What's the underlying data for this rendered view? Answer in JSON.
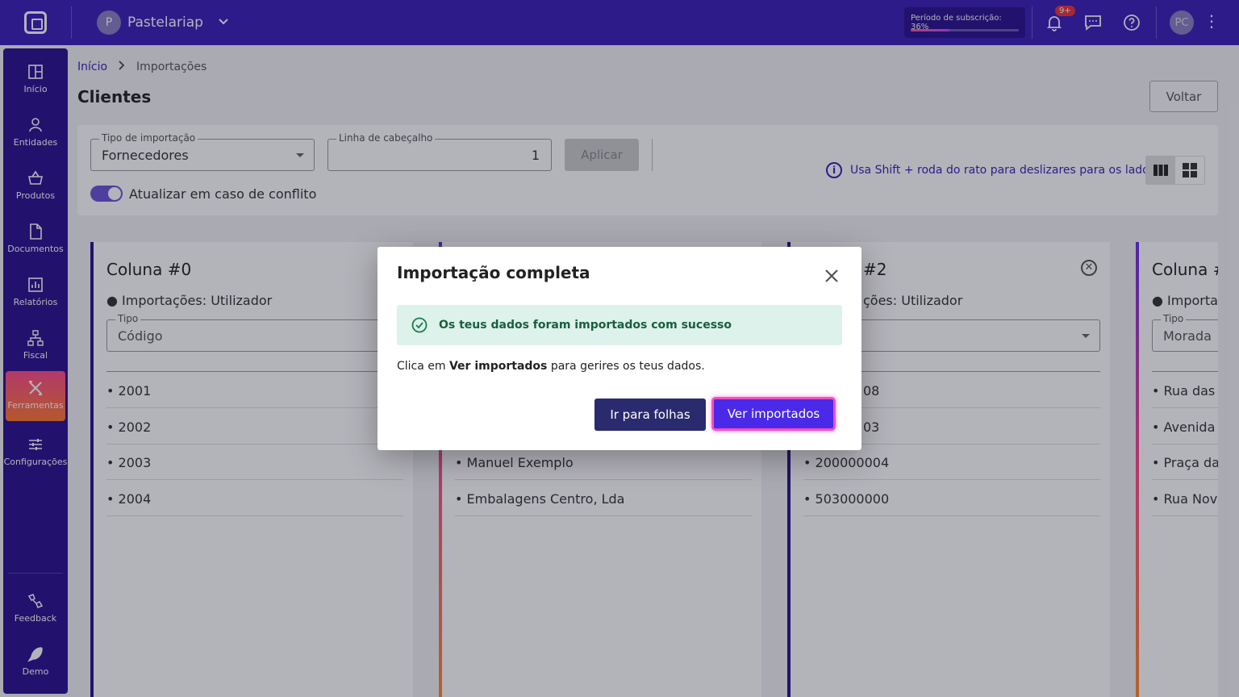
{
  "topbar": {
    "company_initial": "P",
    "company_name": "Pastelariap",
    "subscription_label": "Período de subscrição: 36%",
    "subscription_progress": 0.36,
    "notifications_badge": "9+",
    "user_initials": "PC"
  },
  "sidebar": {
    "items": [
      {
        "label": "Início",
        "icon": "home-icon"
      },
      {
        "label": "Entidades",
        "icon": "person-icon"
      },
      {
        "label": "Produtos",
        "icon": "basket-icon"
      },
      {
        "label": "Documentos",
        "icon": "document-icon"
      },
      {
        "label": "Relatórios",
        "icon": "chart-icon"
      },
      {
        "label": "Fiscal",
        "icon": "hierarchy-icon"
      },
      {
        "label": "Ferramentas",
        "icon": "tools-icon"
      },
      {
        "label": "Configurações",
        "icon": "sliders-icon"
      }
    ],
    "bottom": [
      {
        "label": "Feedback",
        "icon": "feedback-icon"
      },
      {
        "label": "Demo",
        "icon": "rocket-icon"
      }
    ]
  },
  "breadcrumb": {
    "home": "Início",
    "current": "Importações"
  },
  "page": {
    "title": "Clientes",
    "back_label": "Voltar"
  },
  "filters": {
    "import_type_label": "Tipo de importação",
    "import_type_value": "Fornecedores",
    "header_line_label": "Linha de cabeçalho",
    "header_line_value": "1",
    "apply_label": "Aplicar",
    "conflict_label": "Atualizar em caso de conflito",
    "hint": "Usa Shift + roda do rato para deslizares para os lados"
  },
  "columns": [
    {
      "title": "Coluna #0",
      "sub": "Importações: Utilizador",
      "type_label": "Tipo",
      "type_value": "Código",
      "rows": [
        "• 2001",
        "• 2002",
        "• 2003",
        "• 2004"
      ]
    },
    {
      "title": "",
      "sub": "",
      "type_label": "",
      "type_value": "",
      "rows": [
        "",
        "",
        "• Manuel Exemplo",
        "• Embalagens Centro, Lda"
      ]
    },
    {
      "title": "#2",
      "sub": "ções: Utilizador",
      "type_label": "",
      "type_value": "",
      "rows": [
        "08",
        "03",
        "• 200000004",
        "• 503000000"
      ]
    },
    {
      "title": "Coluna #",
      "sub": "Importaç",
      "type_label": "Tipo",
      "type_value": "Morada",
      "rows": [
        "• Rua das F",
        "• Avenida C",
        "• Praça da I",
        "• Rua Nova"
      ]
    }
  ],
  "modal": {
    "title": "Importação completa",
    "success_text": "Os teus dados foram importados com sucesso",
    "msg_prefix": "Clica em ",
    "msg_bold": "Ver importados",
    "msg_suffix": " para gerires os teus dados.",
    "secondary_label": "Ir para folhas",
    "primary_label": "Ver importados"
  },
  "colors": {
    "primary": "#3a1fb8",
    "accent": "#ff4c8a",
    "success_bg": "#dcf2ea"
  }
}
